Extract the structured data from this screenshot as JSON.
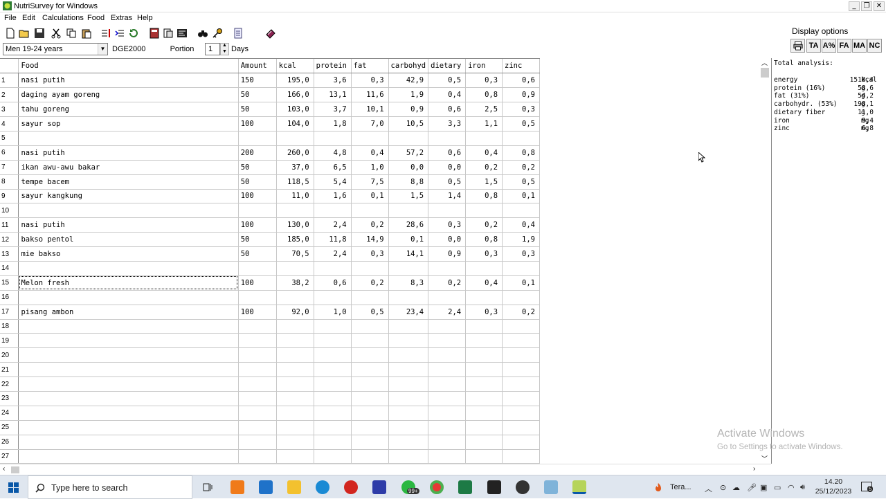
{
  "window": {
    "title": "NutriSurvey for Windows"
  },
  "menu": [
    "File",
    "Edit",
    "Calculations",
    "Food",
    "Extras",
    "Help"
  ],
  "options": {
    "group": "Men 19-24 years",
    "standard": "DGE2000",
    "portion_label": "Portion",
    "days_value": "1",
    "days_label": "Days"
  },
  "display_options": {
    "label": "Display options",
    "buttons": [
      "TA",
      "A%",
      "FA",
      "MA",
      "NC"
    ]
  },
  "table": {
    "headers": [
      "Food",
      "Amount",
      "kcal",
      "protein",
      "fat",
      "carbohyd",
      "dietary",
      "iron",
      "zinc"
    ],
    "rows": [
      {
        "n": "1",
        "food": "nasi putih",
        "amount": "150",
        "kcal": "195,0",
        "protein": "3,6",
        "fat": "0,3",
        "carb": "42,9",
        "dietary": "0,5",
        "iron": "0,3",
        "zinc": "0,6"
      },
      {
        "n": "2",
        "food": "daging ayam goreng",
        "amount": "50",
        "kcal": "166,0",
        "protein": "13,1",
        "fat": "11,6",
        "carb": "1,9",
        "dietary": "0,4",
        "iron": "0,8",
        "zinc": "0,9"
      },
      {
        "n": "3",
        "food": "tahu goreng",
        "amount": "50",
        "kcal": "103,0",
        "protein": "3,7",
        "fat": "10,1",
        "carb": "0,9",
        "dietary": "0,6",
        "iron": "2,5",
        "zinc": "0,3"
      },
      {
        "n": "4",
        "food": "sayur sop",
        "amount": "100",
        "kcal": "104,0",
        "protein": "1,8",
        "fat": "7,0",
        "carb": "10,5",
        "dietary": "3,3",
        "iron": "1,1",
        "zinc": "0,5"
      },
      {
        "n": "5",
        "food": "",
        "amount": "",
        "kcal": "",
        "protein": "",
        "fat": "",
        "carb": "",
        "dietary": "",
        "iron": "",
        "zinc": ""
      },
      {
        "n": "6",
        "food": "nasi putih",
        "amount": "200",
        "kcal": "260,0",
        "protein": "4,8",
        "fat": "0,4",
        "carb": "57,2",
        "dietary": "0,6",
        "iron": "0,4",
        "zinc": "0,8"
      },
      {
        "n": "7",
        "food": "ikan awu-awu bakar",
        "amount": "50",
        "kcal": "37,0",
        "protein": "6,5",
        "fat": "1,0",
        "carb": "0,0",
        "dietary": "0,0",
        "iron": "0,2",
        "zinc": "0,2"
      },
      {
        "n": "8",
        "food": "tempe bacem",
        "amount": "50",
        "kcal": "118,5",
        "protein": "5,4",
        "fat": "7,5",
        "carb": "8,8",
        "dietary": "0,5",
        "iron": "1,5",
        "zinc": "0,5"
      },
      {
        "n": "9",
        "food": "sayur kangkung",
        "amount": "100",
        "kcal": "11,0",
        "protein": "1,6",
        "fat": "0,1",
        "carb": "1,5",
        "dietary": "1,4",
        "iron": "0,8",
        "zinc": "0,1"
      },
      {
        "n": "10",
        "food": "",
        "amount": "",
        "kcal": "",
        "protein": "",
        "fat": "",
        "carb": "",
        "dietary": "",
        "iron": "",
        "zinc": ""
      },
      {
        "n": "11",
        "food": "nasi putih",
        "amount": "100",
        "kcal": "130,0",
        "protein": "2,4",
        "fat": "0,2",
        "carb": "28,6",
        "dietary": "0,3",
        "iron": "0,2",
        "zinc": "0,4"
      },
      {
        "n": "12",
        "food": "bakso pentol",
        "amount": "50",
        "kcal": "185,0",
        "protein": "11,8",
        "fat": "14,9",
        "carb": "0,1",
        "dietary": "0,0",
        "iron": "0,8",
        "zinc": "1,9"
      },
      {
        "n": "13",
        "food": "mie bakso",
        "amount": "50",
        "kcal": "70,5",
        "protein": "2,4",
        "fat": "0,3",
        "carb": "14,1",
        "dietary": "0,9",
        "iron": "0,3",
        "zinc": "0,3"
      },
      {
        "n": "14",
        "food": "",
        "amount": "",
        "kcal": "",
        "protein": "",
        "fat": "",
        "carb": "",
        "dietary": "",
        "iron": "",
        "zinc": ""
      },
      {
        "n": "15",
        "food": "Melon fresh",
        "amount": "100",
        "kcal": "38,2",
        "protein": "0,6",
        "fat": "0,2",
        "carb": "8,3",
        "dietary": "0,2",
        "iron": "0,4",
        "zinc": "0,1"
      },
      {
        "n": "16",
        "food": "",
        "amount": "",
        "kcal": "",
        "protein": "",
        "fat": "",
        "carb": "",
        "dietary": "",
        "iron": "",
        "zinc": ""
      },
      {
        "n": "17",
        "food": "pisang ambon",
        "amount": "100",
        "kcal": "92,0",
        "protein": "1,0",
        "fat": "0,5",
        "carb": "23,4",
        "dietary": "2,4",
        "iron": "0,3",
        "zinc": "0,2"
      },
      {
        "n": "18",
        "food": "",
        "amount": "",
        "kcal": "",
        "protein": "",
        "fat": "",
        "carb": "",
        "dietary": "",
        "iron": "",
        "zinc": ""
      },
      {
        "n": "19",
        "food": "",
        "amount": "",
        "kcal": "",
        "protein": "",
        "fat": "",
        "carb": "",
        "dietary": "",
        "iron": "",
        "zinc": ""
      },
      {
        "n": "20",
        "food": "",
        "amount": "",
        "kcal": "",
        "protein": "",
        "fat": "",
        "carb": "",
        "dietary": "",
        "iron": "",
        "zinc": ""
      },
      {
        "n": "21",
        "food": "",
        "amount": "",
        "kcal": "",
        "protein": "",
        "fat": "",
        "carb": "",
        "dietary": "",
        "iron": "",
        "zinc": ""
      },
      {
        "n": "22",
        "food": "",
        "amount": "",
        "kcal": "",
        "protein": "",
        "fat": "",
        "carb": "",
        "dietary": "",
        "iron": "",
        "zinc": ""
      },
      {
        "n": "23",
        "food": "",
        "amount": "",
        "kcal": "",
        "protein": "",
        "fat": "",
        "carb": "",
        "dietary": "",
        "iron": "",
        "zinc": ""
      },
      {
        "n": "24",
        "food": "",
        "amount": "",
        "kcal": "",
        "protein": "",
        "fat": "",
        "carb": "",
        "dietary": "",
        "iron": "",
        "zinc": ""
      },
      {
        "n": "25",
        "food": "",
        "amount": "",
        "kcal": "",
        "protein": "",
        "fat": "",
        "carb": "",
        "dietary": "",
        "iron": "",
        "zinc": ""
      },
      {
        "n": "26",
        "food": "",
        "amount": "",
        "kcal": "",
        "protein": "",
        "fat": "",
        "carb": "",
        "dietary": "",
        "iron": "",
        "zinc": ""
      },
      {
        "n": "27",
        "food": "",
        "amount": "",
        "kcal": "",
        "protein": "",
        "fat": "",
        "carb": "",
        "dietary": "",
        "iron": "",
        "zinc": ""
      }
    ]
  },
  "analysis": {
    "title": "Total analysis:",
    "items": [
      {
        "name": "energy",
        "value": "1510,4",
        "unit": "kcal"
      },
      {
        "name": "protein (16%)",
        "value": "58,6",
        "unit": "g"
      },
      {
        "name": "fat (31%)",
        "value": "54,2",
        "unit": "g"
      },
      {
        "name": "carbohydr. (53%)",
        "value": "198,1",
        "unit": "g"
      },
      {
        "name": "dietary fiber",
        "value": "11,0",
        "unit": "g"
      },
      {
        "name": "iron",
        "value": "9,4",
        "unit": "mg"
      },
      {
        "name": "zinc",
        "value": "6,8",
        "unit": "mg"
      }
    ]
  },
  "watermark": {
    "line1": "Activate Windows",
    "line2": "Go to Settings to activate Windows."
  },
  "taskbar": {
    "search_placeholder": "Type here to search",
    "badge": "99+",
    "tray_app": "Tera...",
    "time": "14.20",
    "date": "25/12/2023",
    "notifications": "5"
  }
}
